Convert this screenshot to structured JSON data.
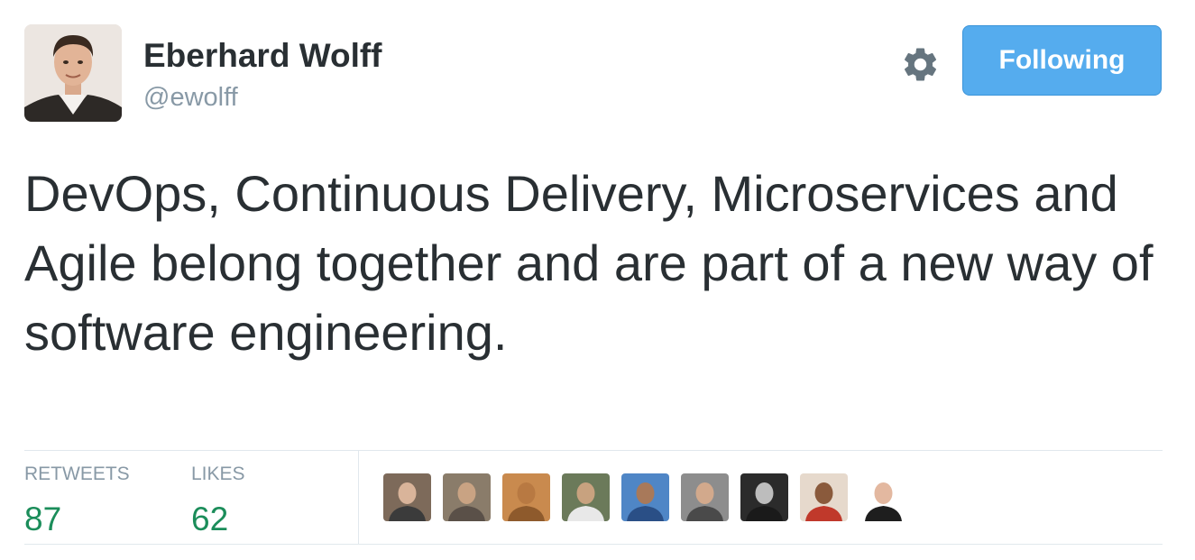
{
  "user": {
    "name": "Eberhard Wolff",
    "handle": "@ewolff"
  },
  "follow_button": {
    "label": "Following"
  },
  "tweet": {
    "text": "DevOps, Continuous Delivery, Microservices and Agile belong together and are part of a new way of software engineering."
  },
  "stats": {
    "retweets": {
      "label": "RETWEETS",
      "value": "87"
    },
    "likes": {
      "label": "LIKES",
      "value": "62"
    }
  },
  "colors": {
    "accent": "#55acee",
    "stat_value": "#1b8d5a",
    "muted": "#8899a6",
    "text": "#292f33"
  },
  "icons": [
    "gear-icon"
  ],
  "facepile": [
    {
      "bg": "#7d6a5a",
      "skin": "#d9b49a",
      "shirt": "#3b3b3b"
    },
    {
      "bg": "#8a7c6a",
      "skin": "#c9a383",
      "shirt": "#5a5048"
    },
    {
      "bg": "#c98a4e",
      "skin": "#b87942",
      "shirt": "#8e5a2c"
    },
    {
      "bg": "#6b7a5a",
      "skin": "#c8a27f",
      "shirt": "#e8e8e8"
    },
    {
      "bg": "#4f86c6",
      "skin": "#a8795a",
      "shirt": "#2a4f86"
    },
    {
      "bg": "#8d8d8d",
      "skin": "#d2a98c",
      "shirt": "#4a4a4a"
    },
    {
      "bg": "#2b2b2b",
      "skin": "#bdbdbd",
      "shirt": "#1a1a1a"
    },
    {
      "bg": "#e6d9cc",
      "skin": "#8a5a3c",
      "shirt": "#c0392b"
    },
    {
      "bg": "#ffffff",
      "skin": "#e3b8a0",
      "shirt": "#1e1e1e"
    }
  ]
}
